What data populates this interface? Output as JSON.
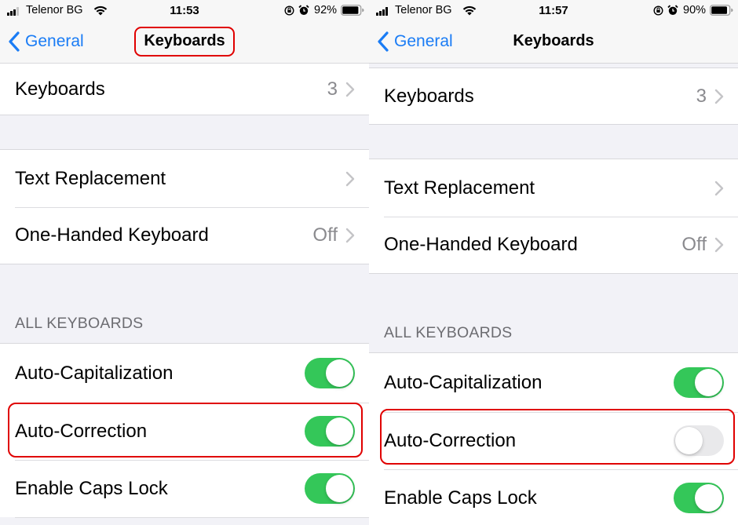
{
  "panels": [
    {
      "status_bar": {
        "carrier": "Telenor BG",
        "time": "11:53",
        "battery_percent": "92%",
        "battery_level": 0.92,
        "icons": [
          "signal-icon",
          "wifi-icon",
          "rotation-lock-icon",
          "alarm-icon",
          "battery-icon"
        ]
      },
      "nav": {
        "back_label": "General",
        "title": "Keyboards",
        "title_highlighted": true
      },
      "groups": [
        {
          "rows": [
            {
              "label": "Keyboards",
              "value": "3",
              "accessory": "chevron"
            }
          ]
        },
        {
          "rows": [
            {
              "label": "Text Replacement",
              "value": "",
              "accessory": "chevron"
            },
            {
              "label": "One-Handed Keyboard",
              "value": "Off",
              "accessory": "chevron"
            }
          ]
        },
        {
          "header": "ALL KEYBOARDS",
          "rows": [
            {
              "label": "Auto-Capitalization",
              "toggle": true
            },
            {
              "label": "Auto-Correction",
              "toggle": true,
              "highlighted": true
            },
            {
              "label": "Enable Caps Lock",
              "toggle": true
            }
          ]
        }
      ]
    },
    {
      "status_bar": {
        "carrier": "Telenor BG",
        "time": "11:57",
        "battery_percent": "90%",
        "battery_level": 0.9,
        "icons": [
          "signal-icon",
          "wifi-icon",
          "rotation-lock-icon",
          "alarm-icon",
          "battery-icon"
        ]
      },
      "nav": {
        "back_label": "General",
        "title": "Keyboards",
        "title_highlighted": false
      },
      "groups": [
        {
          "rows": [
            {
              "label": "Keyboards",
              "value": "3",
              "accessory": "chevron"
            }
          ]
        },
        {
          "rows": [
            {
              "label": "Text Replacement",
              "value": "",
              "accessory": "chevron"
            },
            {
              "label": "One-Handed Keyboard",
              "value": "Off",
              "accessory": "chevron"
            }
          ]
        },
        {
          "header": "ALL KEYBOARDS",
          "rows": [
            {
              "label": "Auto-Capitalization",
              "toggle": true
            },
            {
              "label": "Auto-Correction",
              "toggle": false,
              "highlighted": true
            },
            {
              "label": "Enable Caps Lock",
              "toggle": true
            }
          ]
        }
      ]
    }
  ],
  "colors": {
    "accent": "#1a7cf5",
    "toggle_on": "#34c759",
    "toggle_off": "#e9e9eb",
    "highlight": "#e00000",
    "background": "#f2f2f7",
    "secondary_text": "#8a8a8e",
    "header_text": "#6d6d72"
  }
}
